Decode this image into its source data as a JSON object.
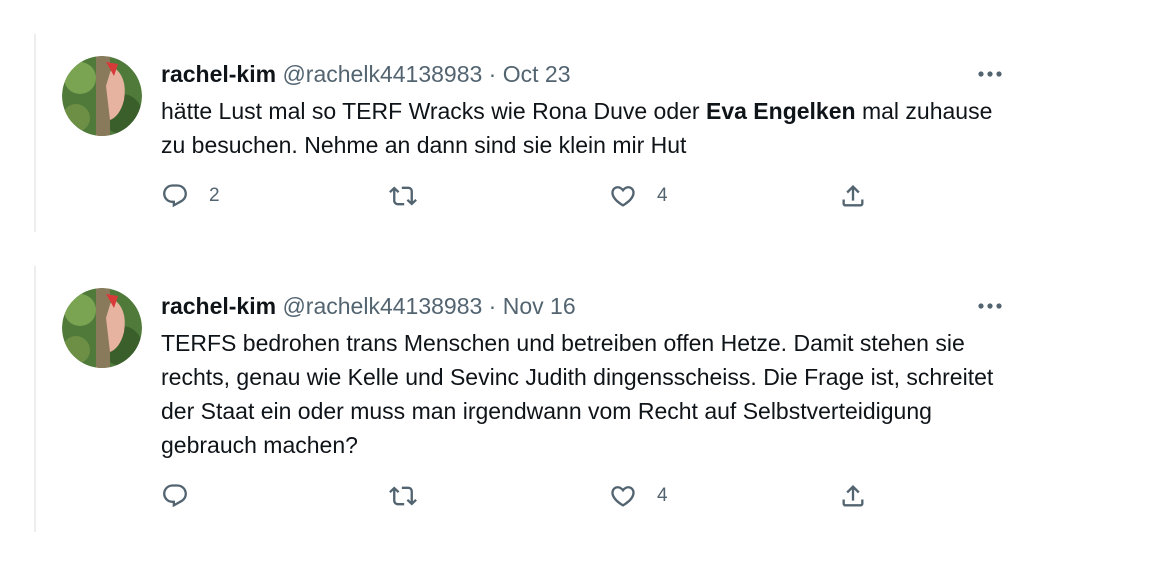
{
  "tweets": [
    {
      "name": "rachel-kim",
      "handle": "@rachelk44138983",
      "separator": "·",
      "date": "Oct 23",
      "text_before": "hätte Lust mal so TERF Wracks wie Rona Duve oder ",
      "text_bold": "Eva Engelken",
      "text_after": " mal zuhause zu besuchen. Nehme an dann sind sie klein mir Hut",
      "reply_count": "2",
      "retweet_count": "",
      "like_count": "4",
      "icons": {
        "reply": "reply-icon",
        "retweet": "retweet-icon",
        "like": "heart-icon",
        "share": "share-icon",
        "more": "more-icon"
      }
    },
    {
      "name": "rachel-kim",
      "handle": "@rachelk44138983",
      "separator": "·",
      "date": "Nov 16",
      "text": "TERFS bedrohen trans Menschen und betreiben offen Hetze. Damit stehen sie rechts, genau wie Kelle und Sevinc Judith dingensscheiss. Die Frage ist, schreitet der Staat ein oder muss man irgendwann vom Recht auf Selbstverteidigung gebrauch machen?",
      "reply_count": "",
      "retweet_count": "",
      "like_count": "4",
      "icons": {
        "reply": "reply-icon",
        "retweet": "retweet-icon",
        "like": "heart-icon",
        "share": "share-icon",
        "more": "more-icon"
      }
    }
  ],
  "colors": {
    "primary_text": "#0f1419",
    "secondary_text": "#536471",
    "divider": "#eceef0"
  }
}
